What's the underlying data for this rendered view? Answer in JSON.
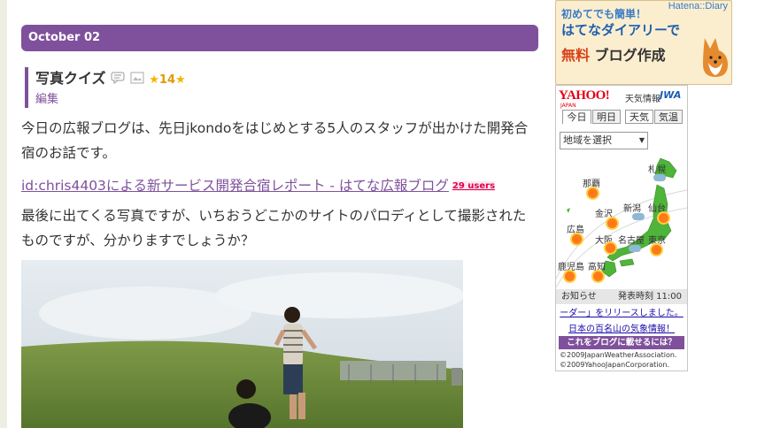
{
  "entry": {
    "date": "October 02",
    "title": "写真クイズ",
    "star_count": "14",
    "edit_label": "編集",
    "paragraph1": "今日の広報ブログは、先日jkondoをはじめとする5人のスタッフが出かけた開発合宿のお話です。",
    "link_text": "id:chris4403による新サービス開発合宿レポート - はてな広報ブログ",
    "users_badge": "29 users",
    "paragraph2": "最後に出てくる写真ですが、いちおうどこかのサイトのパロディとして撮影されたものですが、分かりますでしょうか？"
  },
  "hatena_banner": {
    "tag": "Hatena::Diary",
    "line1": "初めてでも簡単！",
    "line2": "はてなダイアリーで",
    "line3_accent": "無料",
    "line3_rest": "ブログ作成"
  },
  "weather": {
    "logo": "YAHOO!",
    "logo_sub": "JAPAN",
    "title": "天気情報",
    "jwa": "JWA",
    "tabs": [
      "今日",
      "明日",
      "天気",
      "気温"
    ],
    "region_select": "地域を選択",
    "cities": [
      "札幌",
      "那覇",
      "金沢",
      "新潟",
      "仙台",
      "広島",
      "大阪",
      "名古屋",
      "東京",
      "鹿児島",
      "高知"
    ],
    "notice_label": "お知らせ",
    "notice_time": "発表時刻 11:00",
    "news1": "ーダー」をリリースしました。",
    "news2": "日本の百名山の気象情報！",
    "blog_button": "これをブログに載せるには？",
    "copyright1": "©2009JapanWeatherAssociation.",
    "copyright2": "©2009YahooJapanCorporation."
  }
}
